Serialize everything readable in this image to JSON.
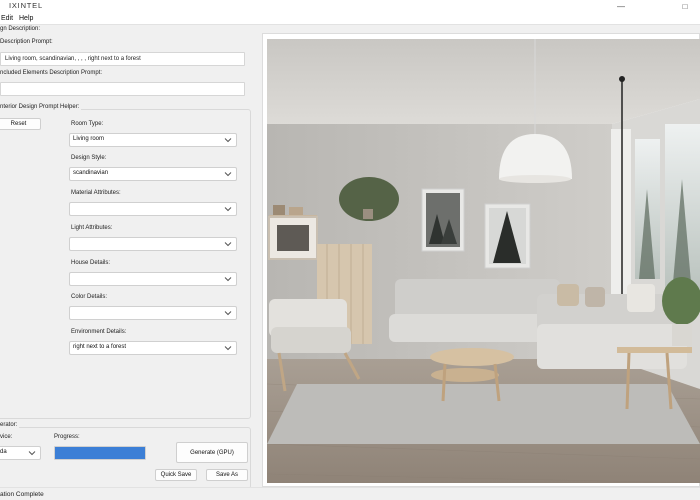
{
  "window": {
    "title": "IXINTEL",
    "minimize_glyph": "—",
    "maximize_glyph": "□"
  },
  "menu": [
    "Edit",
    "Help"
  ],
  "design": {
    "section_label": "gn Description:",
    "description_label": "Description Prompt:",
    "description_value": "Living room, scandinavian, , , , right next to a forest",
    "excluded_label": "ncluded Elements Description Prompt:",
    "excluded_value": ""
  },
  "helper": {
    "label": "nterior Design Prompt Helper:",
    "reset_label": "Reset",
    "attributes": [
      {
        "label": "Room Type:",
        "value": "Living room"
      },
      {
        "label": "Design Style:",
        "value": "scandinavian"
      },
      {
        "label": "Material Attributes:",
        "value": ""
      },
      {
        "label": "Light Attributes:",
        "value": ""
      },
      {
        "label": "House Details:",
        "value": ""
      },
      {
        "label": "Color Details:",
        "value": ""
      },
      {
        "label": "Environment Details:",
        "value": "right next to a forest"
      }
    ]
  },
  "generator": {
    "label": "erator:",
    "device_label": "vice:",
    "device_value": "da",
    "progress_label": "Progress:",
    "progress": 1.0,
    "progress_text": "",
    "generate_label": "Generate (GPU)",
    "quick_save_label": "Quick Save",
    "save_as_label": "Save As"
  },
  "status": {
    "text": "ation Complete"
  },
  "icons": {
    "dropdown": "chevron-down-icon",
    "minimize": "minimize-icon",
    "maximize": "maximize-icon"
  },
  "colors": {
    "accent": "#3c7fd6",
    "panel_bg": "#f0f0f0",
    "field_bg": "#ffffff",
    "border": "#d0d0d0"
  }
}
